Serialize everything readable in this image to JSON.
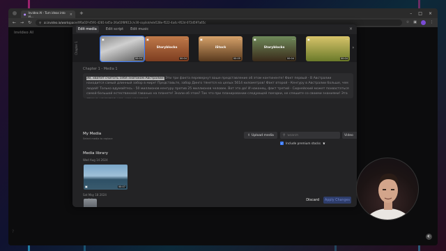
{
  "browser": {
    "tab_title": "Invideo AI - Turn ideas into vi...",
    "url": "ai.invideo.io/workspace/4f6a02f-4591-4281-b45a-26a02f8f612c/v30-copilot/ede528e-f522-4a4c-952d-072d597a65c",
    "new_tab": "+",
    "close_tab": "×"
  },
  "app": {
    "logo": "invideo AI"
  },
  "modal": {
    "tabs": [
      "Edit media",
      "Edit script",
      "Edit music"
    ],
    "close": "×",
    "strip_side_label": "Chapter 1",
    "thumbnails": [
      {
        "label": "",
        "duration": "00:04",
        "selected": true
      },
      {
        "label": "Storyblocks",
        "duration": "00:04",
        "selected": false
      },
      {
        "label": "iStock",
        "duration": "00:05",
        "selected": false
      },
      {
        "label": "Storyblocks",
        "duration": "00:04",
        "selected": false
      },
      {
        "label": "",
        "duration": "00:04",
        "selected": false
      }
    ],
    "chapter_label": "Chapter 1 - Media 1",
    "script_highlight": "Эй, хватит считать себя знатоком Австралии!",
    "script_rest": " Эти три факта перевернут ваше представление об этом континенте! Факт первый - В Австралии находится самый длинный забор в мире! Представьте, забор Динго тянется на целых 5614 километров! Факт второй - Кенгуру в Австралии больше, чем людей! Только вдумайтесь - 50 миллионов кенгуру против 25 миллионов человек. Вот это да! И наконец, факт третий - Сиднейский может похвастаться самой большой естественной гаванью на планете! Знали об этом? Так что при планировании следующей поездки, не спешите со своими знаниями! Эта страна удивительнее, чем кажется!",
    "my_media": {
      "title": "My Media",
      "subtitle": "Select media to replace",
      "upload_label": "Upload media",
      "search_placeholder": "Search",
      "type_value": "Video",
      "premium_label": "Include premium stocks"
    },
    "library": {
      "title": "Media library",
      "groups": [
        {
          "date": "Wed Aug 14 2024",
          "duration": "00:07"
        },
        {
          "date": "Sat May 18 2024",
          "duration": ""
        }
      ]
    },
    "version": "v2.0",
    "discard_label": "Discard",
    "apply_label": "Apply Changes"
  },
  "icons": {
    "back": "back-arrow-icon",
    "forward": "forward-arrow-icon",
    "reload": "reload-icon",
    "upload": "upload-icon",
    "search": "search-icon",
    "chevron": "chevron-down-icon",
    "next": "chevron-right-icon"
  },
  "colors": {
    "accent": "#3a7bff",
    "modal_bg": "#232325"
  }
}
